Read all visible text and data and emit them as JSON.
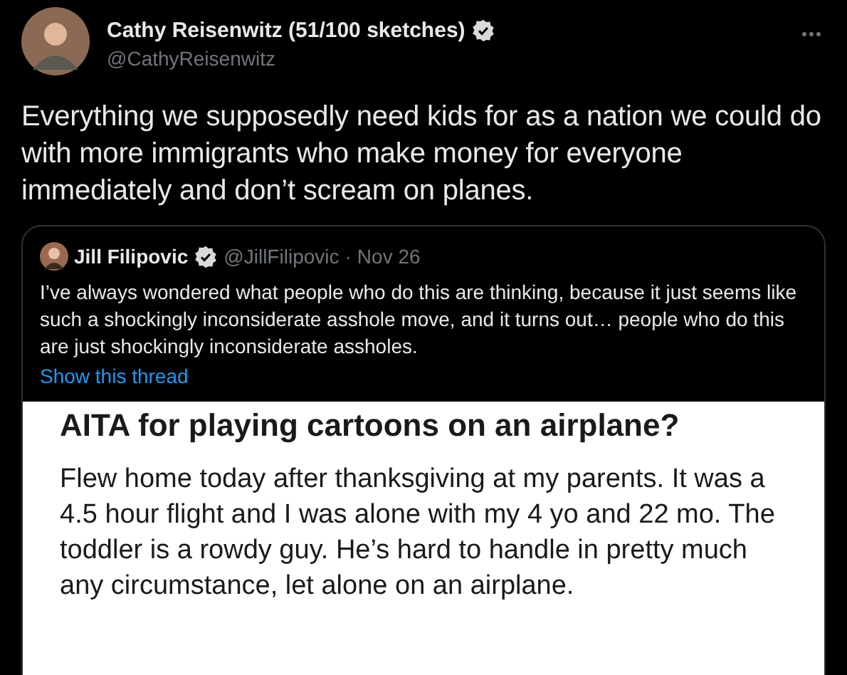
{
  "tweet": {
    "author": {
      "name": "Cathy Reisenwitz (51/100 sketches)",
      "verified": true,
      "handle": "@CathyReisenwitz"
    },
    "text": "Everything we supposedly need kids for as a nation we could do with more immigrants who make money for everyone immediately and don’t scream on planes.",
    "quoted": {
      "author": {
        "name": "Jill Filipovic",
        "verified": true,
        "handle": "@JillFilipovic",
        "separator": "·",
        "date": "Nov 26"
      },
      "text": "I’ve always wondered what people who do this are thinking, because it just seems like such a shockingly inconsiderate asshole move, and it turns out… people who do this are just shockingly inconsiderate assholes.",
      "link": "Show this thread",
      "screenshot": {
        "title": "AITA for playing cartoons on an airplane?",
        "body": "Flew home today after thanksgiving at my parents. It was a 4.5 hour flight and I was alone with my 4 yo and 22 mo. The toddler is a rowdy guy. He’s hard to handle in pretty much any circumstance, let alone on an airplane."
      }
    }
  }
}
